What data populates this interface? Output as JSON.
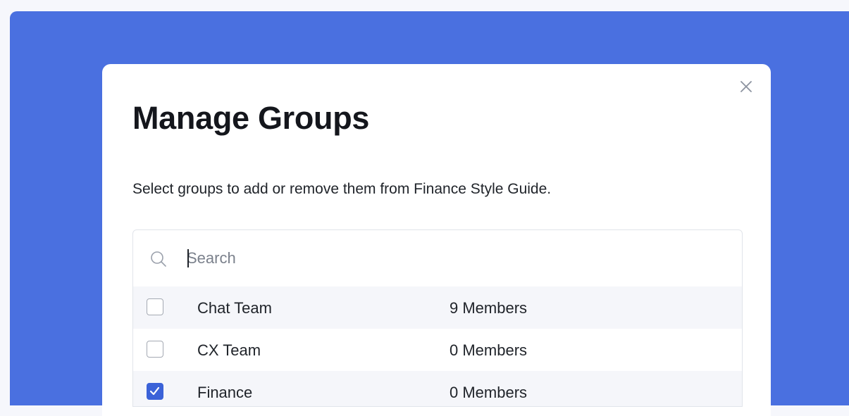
{
  "dialog": {
    "title": "Manage Groups",
    "description": "Select groups to add or remove them from Finance Style Guide.",
    "close_icon": "close-icon"
  },
  "search": {
    "placeholder": "Search",
    "value": "",
    "icon": "search-icon"
  },
  "groups": [
    {
      "name": "Chat Team",
      "members": "9 Members",
      "checked": false
    },
    {
      "name": "CX Team",
      "members": "0 Members",
      "checked": false
    },
    {
      "name": "Finance",
      "members": "0 Members",
      "checked": true
    }
  ],
  "colors": {
    "backdrop": "#4a70e0",
    "checkbox_checked": "#3b62d8",
    "row_alt": "#f5f6fa",
    "text": "#1f2329"
  }
}
